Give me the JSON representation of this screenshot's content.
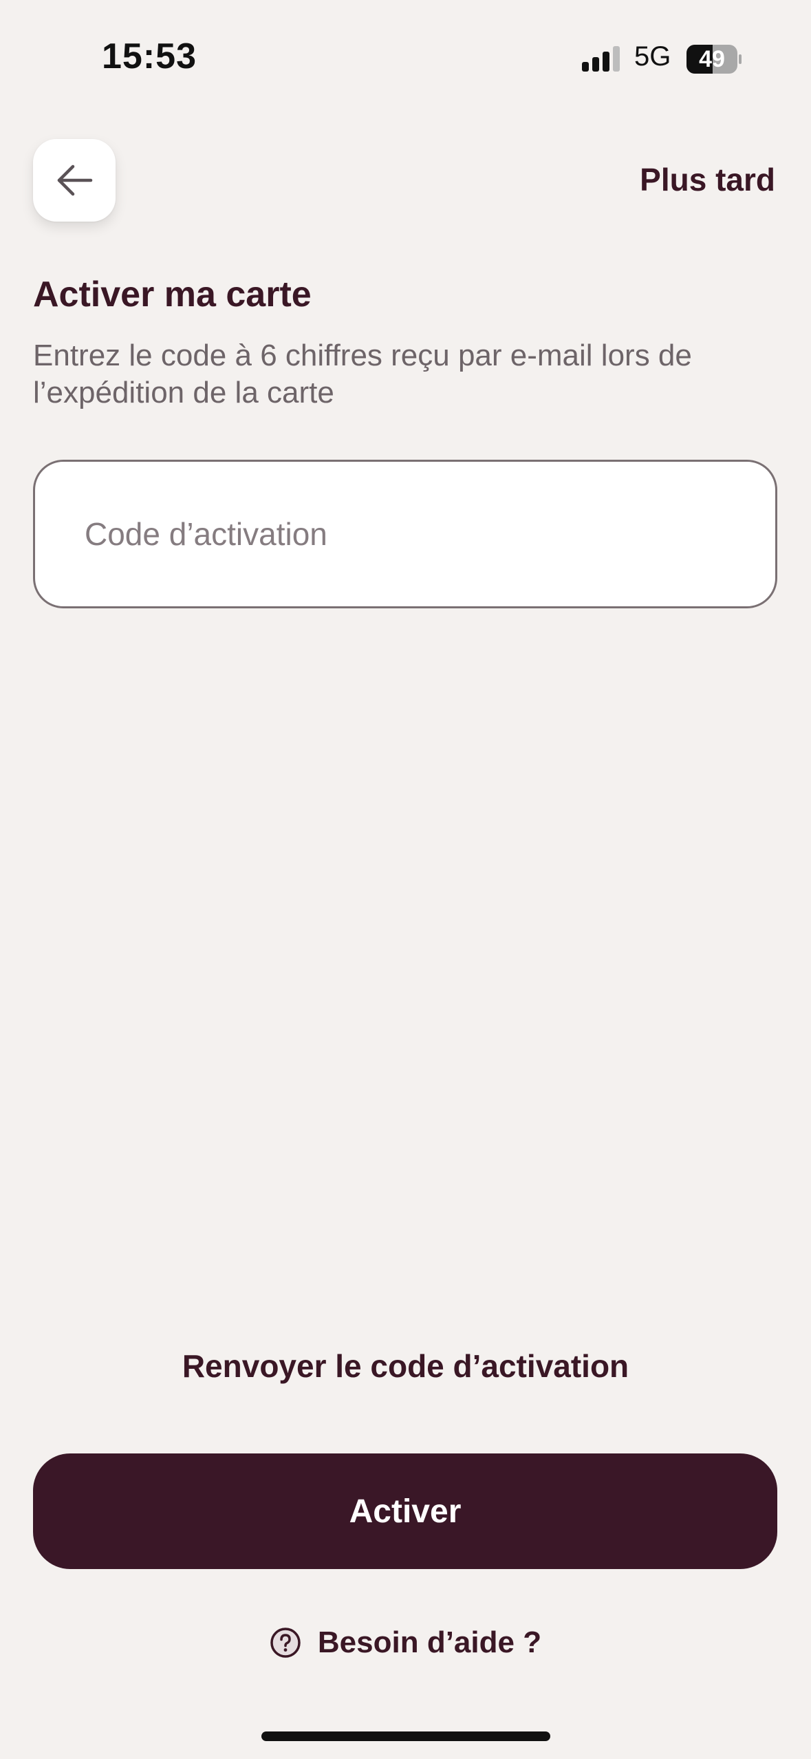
{
  "status_bar": {
    "time": "15:53",
    "network": "5G",
    "battery": "49",
    "icons": [
      "signal-icon",
      "battery-icon"
    ]
  },
  "header": {
    "back_icon": "arrow-left-icon",
    "later_label": "Plus tard"
  },
  "content": {
    "title": "Activer ma carte",
    "subtitle": "Entrez le code à 6 chiffres reçu par e-mail lors de l’expédition de la carte",
    "code_input": {
      "value": "",
      "placeholder": "Code d’activation"
    }
  },
  "footer": {
    "resend_label": "Renvoyer le code d’activation",
    "activate_label": "Activer",
    "help_icon": "question-circle-icon",
    "help_label": "Besoin d’aide ?"
  },
  "colors": {
    "background": "#f4f1ef",
    "primary": "#3a1727",
    "text_secondary": "#6d6468"
  }
}
